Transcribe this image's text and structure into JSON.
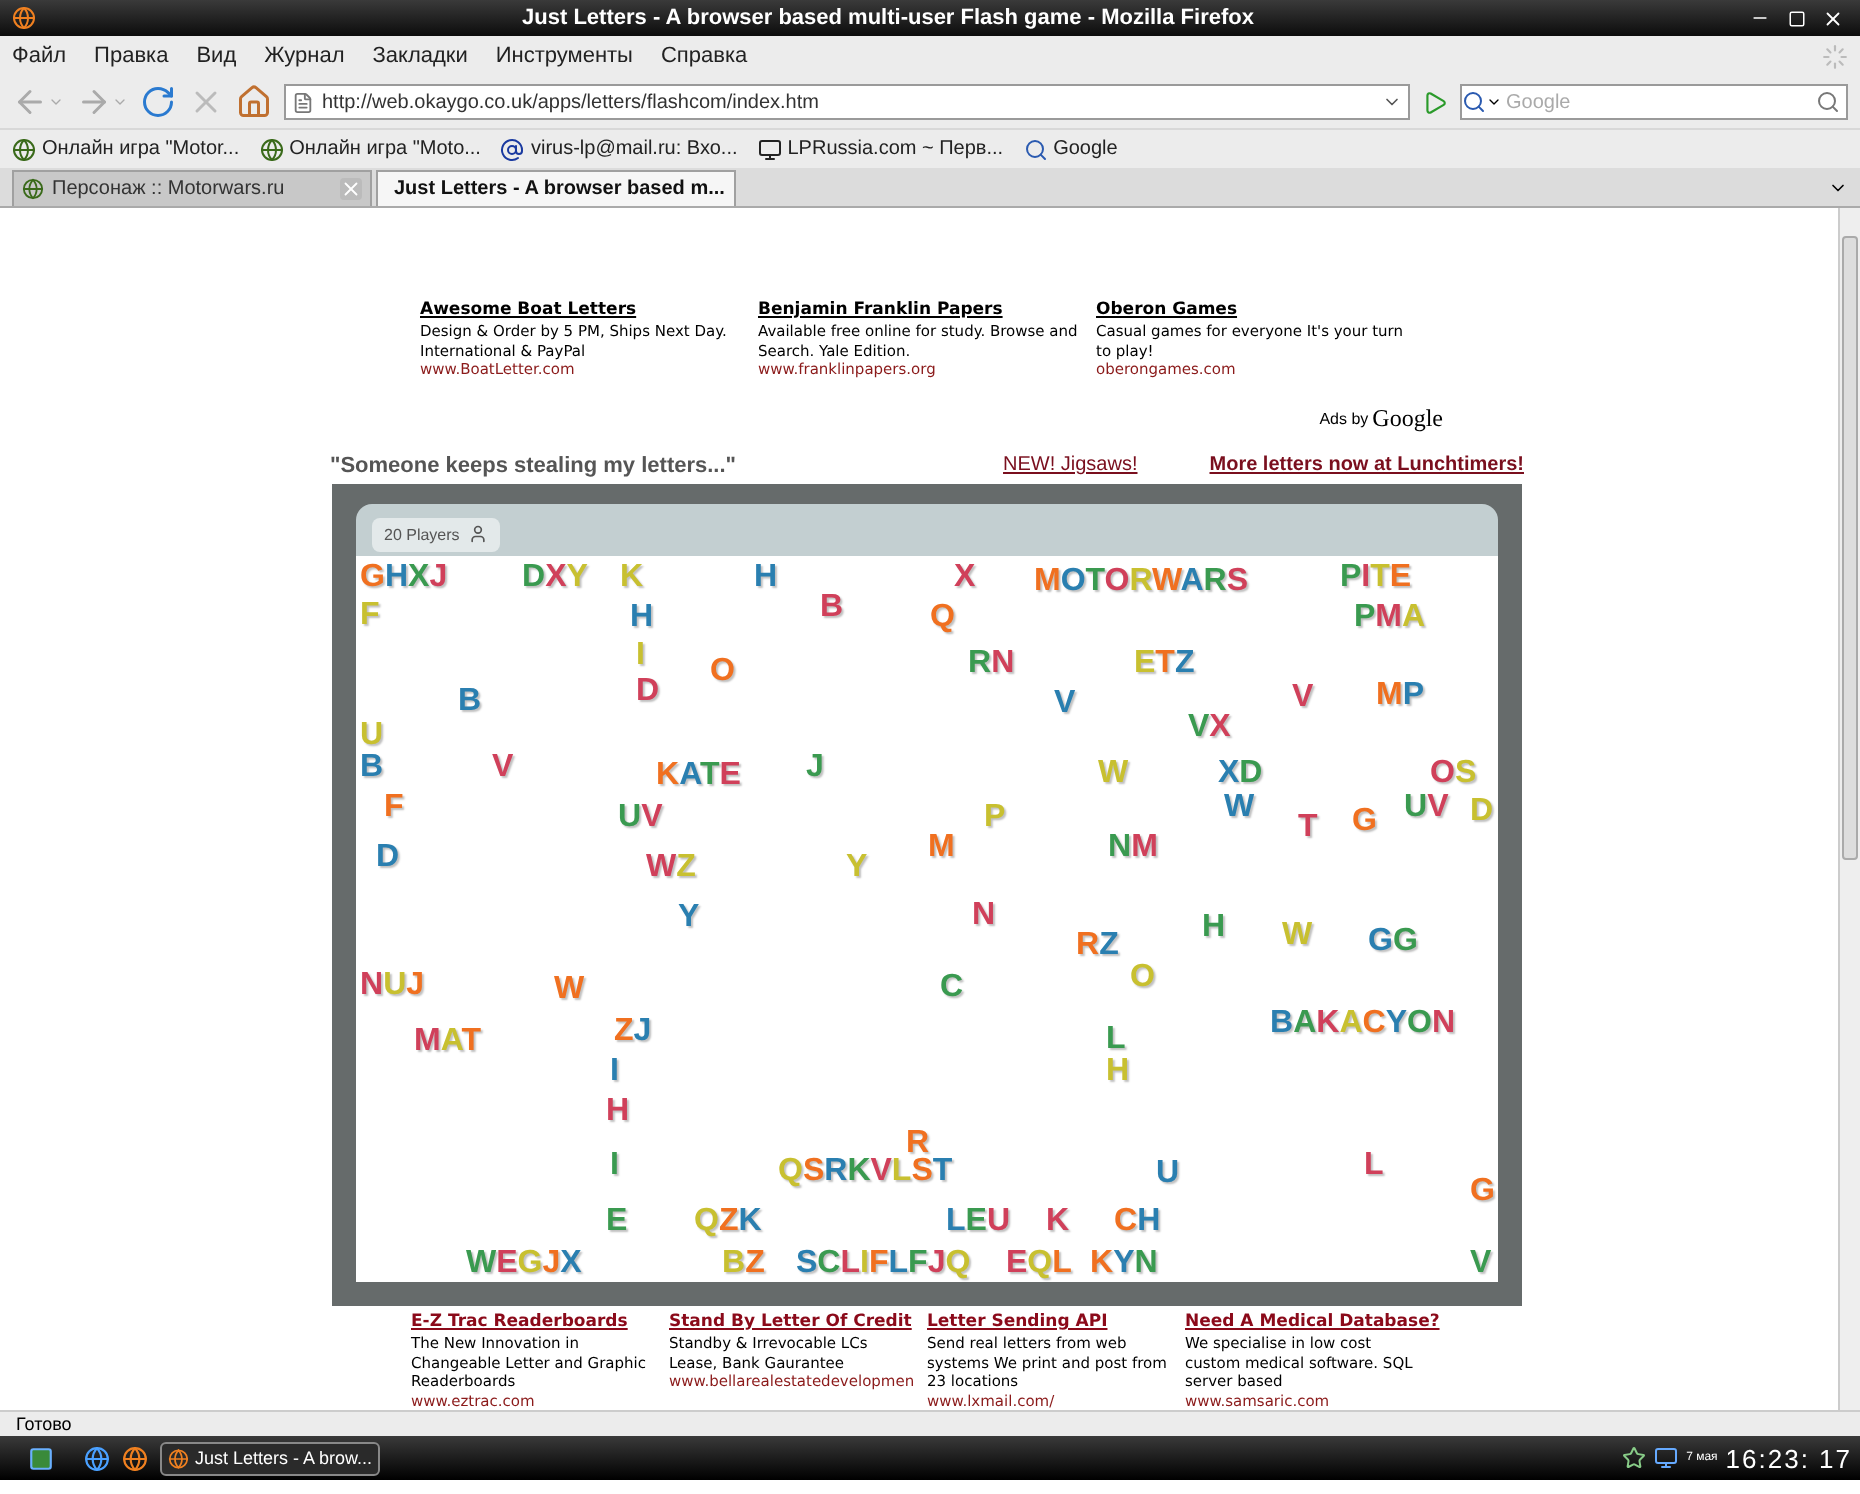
{
  "window": {
    "title": "Just Letters - A browser based multi-user Flash game - Mozilla Firefox"
  },
  "menu": [
    "Файл",
    "Правка",
    "Вид",
    "Журнал",
    "Закладки",
    "Инструменты",
    "Справка"
  ],
  "address_bar": {
    "value": "http://web.okaygo.co.uk/apps/letters/flashcom/index.htm"
  },
  "search": {
    "placeholder": "Google"
  },
  "bookmarks": [
    {
      "label": "Онлайн игра \"Motor...",
      "kind": "site"
    },
    {
      "label": "Онлайн игра \"Moto...",
      "kind": "site"
    },
    {
      "label": "virus-lp@mail.ru: Вхо...",
      "kind": "mail"
    },
    {
      "label": "LPRussia.com ~ Перв...",
      "kind": "lp"
    },
    {
      "label": "Google",
      "kind": "google"
    }
  ],
  "tabs": [
    {
      "label": "Персонаж :: Motorwars.ru",
      "selected": false
    },
    {
      "label": "Just Letters - A browser based m...",
      "selected": true
    }
  ],
  "top_ads": [
    {
      "title": "Awesome Boat Letters",
      "text": "Design & Order by 5 PM, Ships Next Day. International & PayPal",
      "url": "www.BoatLetter.com"
    },
    {
      "title": "Benjamin Franklin Papers",
      "text": "Available free online for study. Browse and Search. Yale Edition.",
      "url": "www.franklinpapers.org"
    },
    {
      "title": "Oberon Games",
      "text": "Casual games for everyone It's your turn to play!",
      "url": "oberongames.com"
    }
  ],
  "ads_by": "Ads by",
  "ads_brand": "Google",
  "tagline": "\"Someone keeps stealing my letters...\"",
  "links": [
    {
      "label": "NEW! Jigsaws!",
      "bold": false
    },
    {
      "label": "More letters now at Lunchtimers!",
      "bold": true
    }
  ],
  "game": {
    "players": "20 Players",
    "letters": [
      "GHXJ",
      "DXY",
      "K",
      "H",
      "X",
      "MOTORWARS",
      "PITE",
      "F",
      "H",
      "B",
      "Q",
      "PMA",
      "I",
      "B",
      "D",
      "O",
      "RN",
      "ETZ",
      "V",
      "V",
      "MP",
      "VX",
      "U",
      "B",
      "V",
      "KATE",
      "J",
      "W",
      "XD",
      "OS",
      "F",
      "UV",
      "P",
      "W",
      "T",
      "G",
      "UV",
      "D",
      "D",
      "WZ",
      "M",
      "NM",
      "Y",
      "Y",
      "N",
      "RZ",
      "H",
      "W",
      "GG",
      "NUJ",
      "W",
      "C",
      "O",
      "BAKACYON",
      "MAT",
      "ZJ",
      "L",
      "H",
      "I",
      "H",
      "R",
      "I",
      "QSRKVLST",
      "U",
      "L",
      "G",
      "E",
      "QZK",
      "LEU",
      "K",
      "CH",
      "WEGJX",
      "BZ",
      "SCLIFLFJQ",
      "EQL",
      "KYN",
      "V"
    ]
  },
  "bottom_ads": [
    {
      "title": "E-Z Trac Readerboards",
      "text": "The New Innovation in Changeable Letter and Graphic Readerboards",
      "url": "www.eztrac.com"
    },
    {
      "title": "Stand By Letter Of Credit",
      "text": "Standby & Irrevocable LCs Lease, Bank Gaurantee",
      "url": "www.bellarealestatedevelopmen"
    },
    {
      "title": "Letter Sending API",
      "text": "Send real letters from web systems We print and post from 23 locations",
      "url": "www.lxmail.com/"
    },
    {
      "title": "Need A Medical Database?",
      "text": "We specialise in low cost custom medical software. SQL server based",
      "url": "www.samsaric.com"
    }
  ],
  "status_bar": "Готово",
  "taskbar": {
    "task": "Just Letters - A brow...",
    "date": "7 мая",
    "clock": "16:23: 17"
  }
}
